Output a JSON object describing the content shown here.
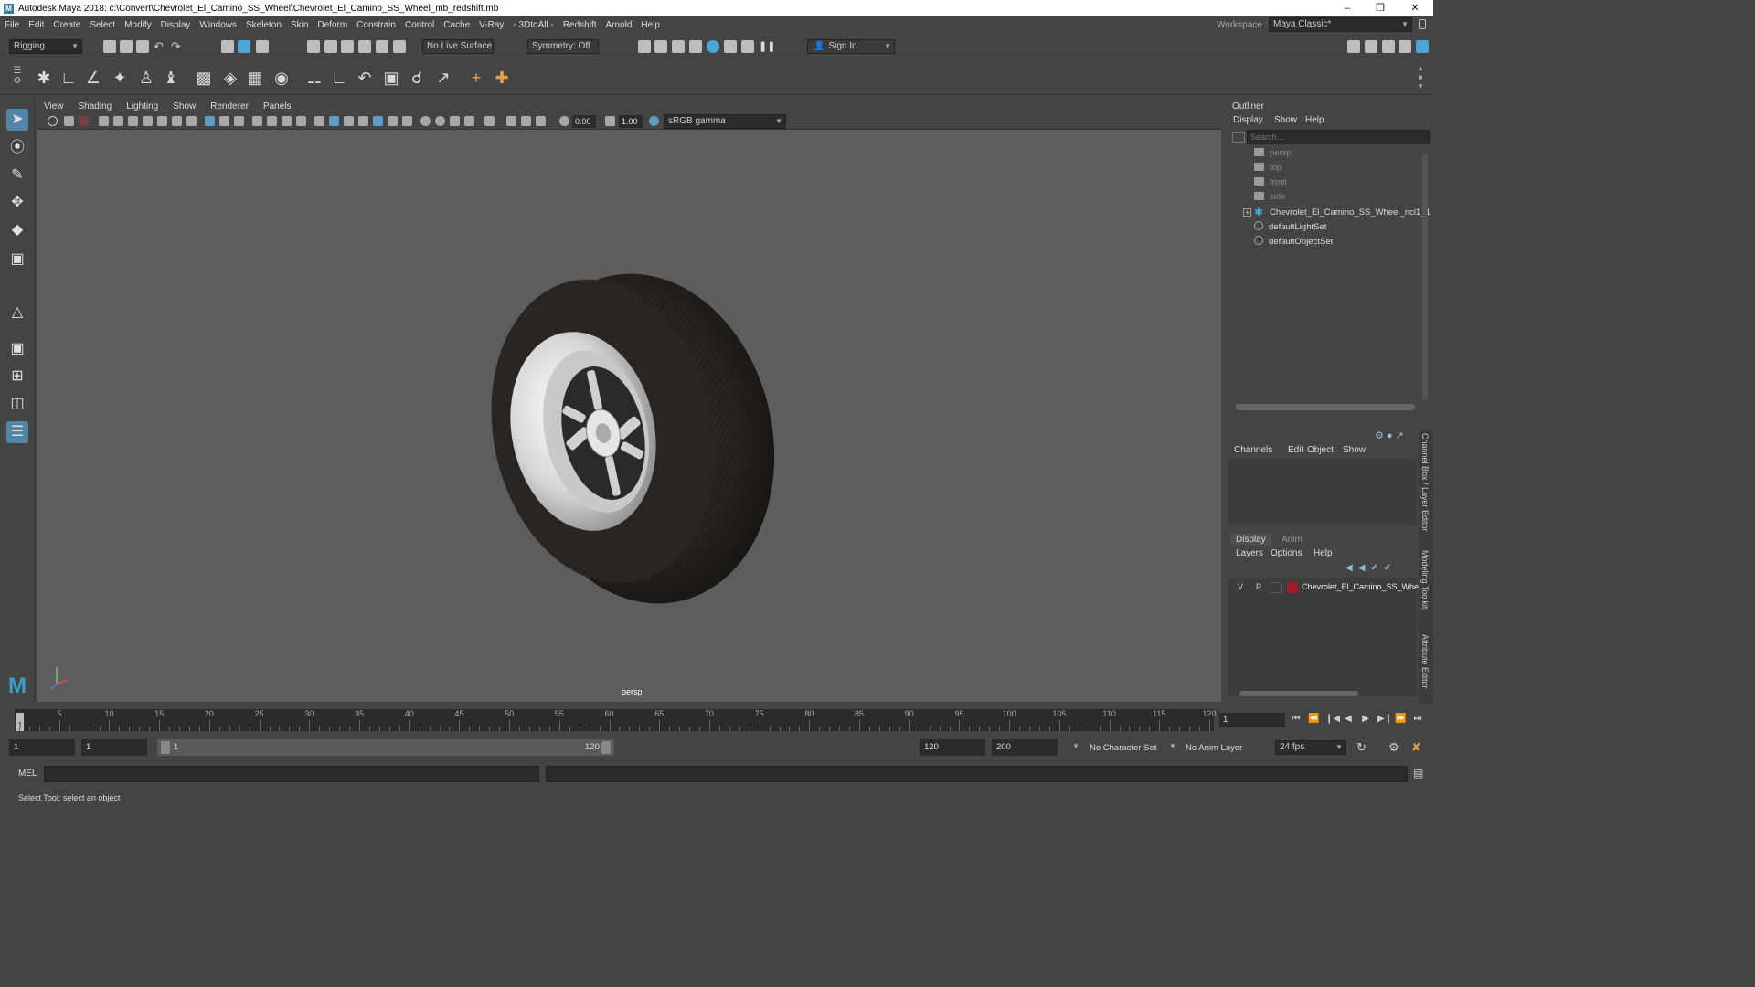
{
  "window": {
    "title": "Autodesk Maya 2018: c:\\Convert\\Chevrolet_El_Camino_SS_Wheel\\Chevrolet_El_Camino_SS_Wheel_mb_redshift.mb"
  },
  "menubar": {
    "items": [
      "File",
      "Edit",
      "Create",
      "Select",
      "Modify",
      "Display",
      "Windows",
      "Skeleton",
      "Skin",
      "Deform",
      "Constrain",
      "Control",
      "Cache",
      "V-Ray",
      "- 3DtoAll -",
      "Redshift",
      "Arnold",
      "Help"
    ]
  },
  "workspace": {
    "label": "Workspace :",
    "value": "Maya Classic*"
  },
  "statusline": {
    "menuset": "Rigging",
    "live_surface": "No Live Surface",
    "symmetry": "Symmetry: Off",
    "sign_in": "Sign In"
  },
  "viewport": {
    "menu": [
      "View",
      "Shading",
      "Lighting",
      "Show",
      "Renderer",
      "Panels"
    ],
    "exposure": "0.00",
    "gamma": "1.00",
    "colorspace": "sRGB gamma",
    "camera": "persp"
  },
  "outliner": {
    "title": "Outliner",
    "menu": [
      "Display",
      "Show",
      "Help"
    ],
    "search_placeholder": "Search...",
    "items": [
      {
        "label": "persp",
        "icon": "camera-icon"
      },
      {
        "label": "top",
        "icon": "camera-icon"
      },
      {
        "label": "front",
        "icon": "camera-icon"
      },
      {
        "label": "side",
        "icon": "camera-icon"
      },
      {
        "label": "Chevrolet_El_Camino_SS_Wheel_ncl1_1",
        "icon": "transform-icon"
      },
      {
        "label": "defaultLightSet",
        "icon": "set-icon"
      },
      {
        "label": "defaultObjectSet",
        "icon": "set-icon"
      }
    ]
  },
  "channelbox": {
    "menu": [
      "Channels",
      "Edit",
      "Object",
      "Show"
    ]
  },
  "layers": {
    "tabs": [
      "Display",
      "Anim"
    ],
    "menu": [
      "Layers",
      "Options",
      "Help"
    ],
    "row": {
      "v": "V",
      "p": "P",
      "name": "Chevrolet_El_Camino_SS_Whe",
      "color": "#a01a2a"
    }
  },
  "sidetabs": [
    "Channel Box / Layer Editor",
    "Modeling Toolkit",
    "Attribute Editor"
  ],
  "timeline": {
    "ticks": [
      "5",
      "10",
      "15",
      "20",
      "25",
      "30",
      "35",
      "40",
      "45",
      "50",
      "55",
      "60",
      "65",
      "70",
      "75",
      "80",
      "85",
      "90",
      "95",
      "100",
      "105",
      "110",
      "115",
      "120"
    ],
    "start_marker": "1",
    "current_frame": "1"
  },
  "range": {
    "start_time": "1",
    "playback_start": "1",
    "slider_start": "1",
    "slider_end": "120",
    "playback_end": "120",
    "end_time": "200",
    "character_set": "No Character Set",
    "anim_layer": "No Anim Layer",
    "fps": "24 fps"
  },
  "cmdline": {
    "label": "MEL"
  },
  "helpline": {
    "text": "Select Tool: select an object"
  }
}
